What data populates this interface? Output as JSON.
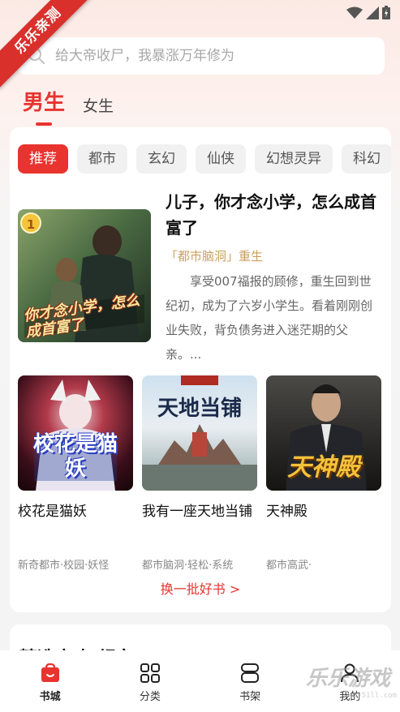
{
  "ribbon": {
    "text": "乐乐亲测"
  },
  "search": {
    "placeholder": "给大帝收尸，我暴涨万年修为"
  },
  "gender_tabs": [
    {
      "label": "男生",
      "active": true
    },
    {
      "label": "女生",
      "active": false
    }
  ],
  "categories": [
    "推荐",
    "都市",
    "玄幻",
    "仙侠",
    "幻想灵异",
    "科幻"
  ],
  "featured": {
    "rank": "1",
    "title": "儿子，你才念小学，怎么成首富了",
    "tags": "「都市脑洞」重生",
    "description": "享受007福报的顾修，重生回到世纪初，成为了六岁小学生。看着刚刚创业失败，背负债务进入迷茫期的父亲。...",
    "cover_text": "你才念小学，怎么成首富了"
  },
  "books": [
    {
      "title": "校花是猫妖",
      "tags": "新奇都市·校园·妖怪",
      "cover_text": "校花是猫妖"
    },
    {
      "title": "我有一座天地当铺",
      "tags": "都市脑洞·轻松·系统",
      "cover_text": "天地当铺"
    },
    {
      "title": "天神殿",
      "tags": "都市高武·",
      "cover_text": "天神殿"
    }
  ],
  "refresh": {
    "label": "换一批好书 >"
  },
  "section2": {
    "title": "精选高吃·都市"
  },
  "bottom_nav": [
    {
      "label": "书城",
      "icon": "bookstore-icon",
      "active": true
    },
    {
      "label": "分类",
      "icon": "grid-icon",
      "active": false
    },
    {
      "label": "书架",
      "icon": "bookshelf-icon",
      "active": false
    },
    {
      "label": "我的",
      "icon": "user-icon",
      "active": false
    }
  ],
  "watermark": {
    "big": "乐乐游戏",
    "small": "www.51ll.com"
  },
  "colors": {
    "accent": "#e8332f",
    "tag_gold": "#c9a060"
  }
}
